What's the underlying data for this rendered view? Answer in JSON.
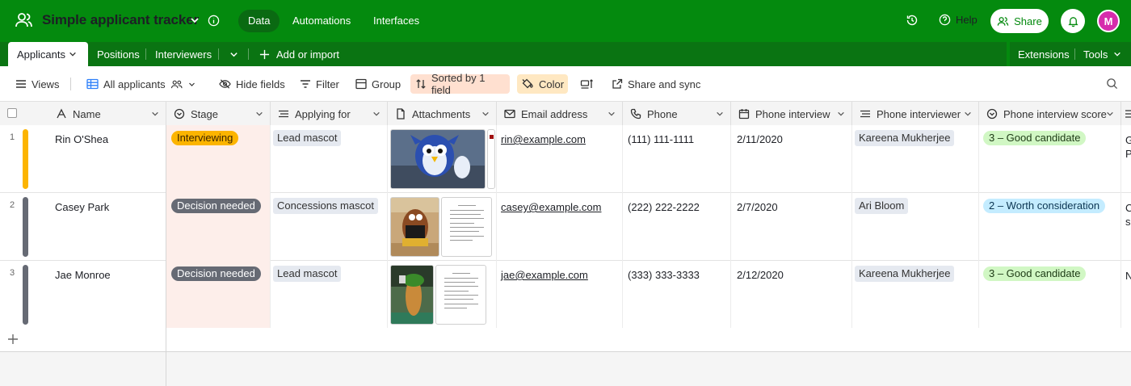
{
  "app": {
    "base_title": "Simple applicant tracker",
    "nav": [
      "Data",
      "Automations",
      "Interfaces"
    ],
    "help_label": "Help",
    "share_label": "Share",
    "avatar_initial": "M",
    "brand_color": "#048a0e"
  },
  "tabs": {
    "items": [
      "Applicants",
      "Positions",
      "Interviewers"
    ],
    "add_label": "Add or import",
    "extensions_label": "Extensions",
    "tools_label": "Tools"
  },
  "toolbar": {
    "views_label": "Views",
    "view_name": "All applicants",
    "hide_fields_label": "Hide fields",
    "filter_label": "Filter",
    "group_label": "Group",
    "sorted_label": "Sorted by 1 field",
    "color_label": "Color",
    "share_sync_label": "Share and sync"
  },
  "columns": [
    "Name",
    "Stage",
    "Applying for",
    "Attachments",
    "Email address",
    "Phone",
    "Phone interview",
    "Phone interviewer",
    "Phone interview score"
  ],
  "rows": [
    {
      "num": "1",
      "name": "Rin O'Shea",
      "stage": "Interviewing",
      "applying_for": "Lead mascot",
      "email": "rin@example.com",
      "phone": "(111) 111-1111",
      "phone_interview": "2/11/2020",
      "interviewer": "Kareena Mukherjee",
      "score": "3 – Good candidate",
      "overflow": "G\nP",
      "bar_color": "#fcb400"
    },
    {
      "num": "2",
      "name": "Casey Park",
      "stage": "Decision needed",
      "applying_for": "Concessions mascot",
      "email": "casey@example.com",
      "phone": "(222) 222-2222",
      "phone_interview": "2/7/2020",
      "interviewer": "Ari Bloom",
      "score": "2 – Worth consideration",
      "overflow": "C\ns",
      "bar_color": "#666a74"
    },
    {
      "num": "3",
      "name": "Jae Monroe",
      "stage": "Decision needed",
      "applying_for": "Lead mascot",
      "email": "jae@example.com",
      "phone": "(333) 333-3333",
      "phone_interview": "2/12/2020",
      "interviewer": "Kareena Mukherjee",
      "score": "3 – Good candidate",
      "overflow": "N",
      "bar_color": "#666a74"
    }
  ]
}
